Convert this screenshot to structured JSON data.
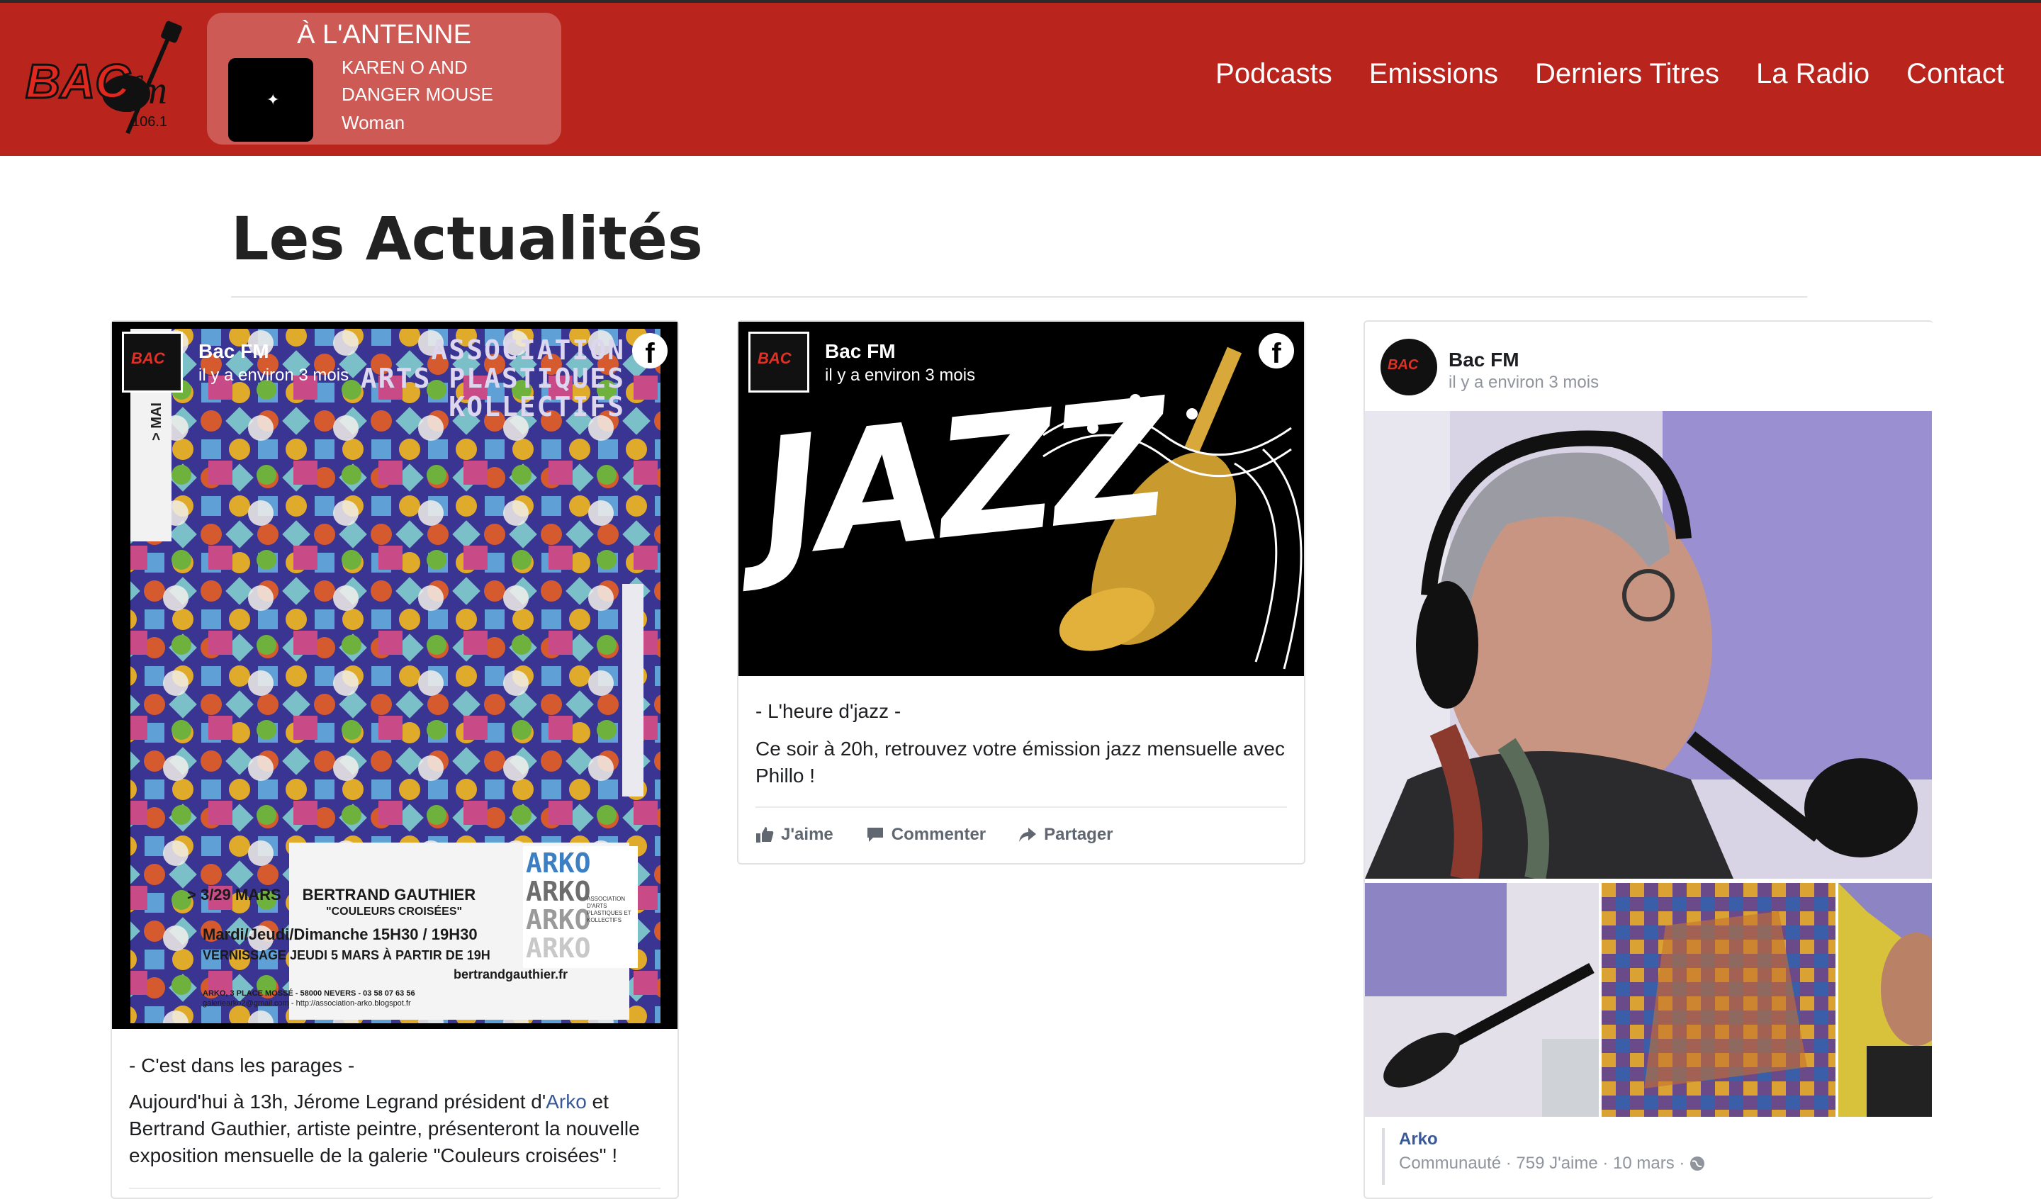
{
  "header": {
    "logo_text": "BAC fm 106.1",
    "on_air": {
      "title": "À L'ANTENNE",
      "artist": "KAREN O AND DANGER MOUSE",
      "song": "Woman",
      "cover_glyph": "✦"
    },
    "nav": [
      "Podcasts",
      "Emissions",
      "Derniers Titres",
      "La Radio",
      "Contact"
    ]
  },
  "main": {
    "title": "Les Actualités"
  },
  "posts": [
    {
      "page_name": "Bac FM",
      "time": "il y a environ 3 mois",
      "poster": {
        "top_lines": [
          "ASSOCIATION",
          "ARTS PLASTIQUES",
          "KOLLECTIFS"
        ],
        "side_tab": "> MAI",
        "dates": "> 3/29 MARS",
        "artist": "BERTRAND GAUTHIER",
        "expo": "\"COULEURS CROISÉES\"",
        "hours": "Mardi/Jeudi/Dimanche 15H30 / 19H30",
        "vernissage": "VERNISSAGE JEUDI 5 MARS À PARTIR DE 19H",
        "website": "bertrandgauthier.fr",
        "address": "ARKO, 3 PLACE MOSSÉ - 58000 NEVERS - 03 58 07 63 56",
        "contact": "galeriearko2@gmail.com - http://association-arko.blogspot.fr",
        "arko_word": "ARKO",
        "arko_subtitle": "ASSOCIATION D'ARTS PLASTIQUES ET KOLLECTIFS"
      },
      "tag": "- C'est dans les parages -",
      "body_before": "Aujourd'hui à 13h, Jérome Legrand président d'",
      "body_link": "Arko",
      "body_after": " et Bertrand Gauthier, artiste peintre, présenteront la nouvelle exposition mensuelle de la galerie \"Couleurs croisées\" !"
    },
    {
      "page_name": "Bac FM",
      "time": "il y a environ 3 mois",
      "image_word": "JAZZ",
      "tag": "- L'heure d'jazz -",
      "body": "Ce soir à 20h, retrouvez votre émission jazz mensuelle avec Phillo !",
      "actions": {
        "like": "J'aime",
        "comment": "Commenter",
        "share": "Partager"
      }
    },
    {
      "page_name": "Bac FM",
      "time": "il y a environ 3 mois",
      "shared_page": {
        "name": "Arko",
        "meta": "Communauté · 759 J'aime · 10 mars · "
      }
    }
  ],
  "colors": {
    "header_red": "#b9241d",
    "on_air_bg": "#cd5a54",
    "link_blue": "#385898",
    "action_grey": "#606770"
  }
}
